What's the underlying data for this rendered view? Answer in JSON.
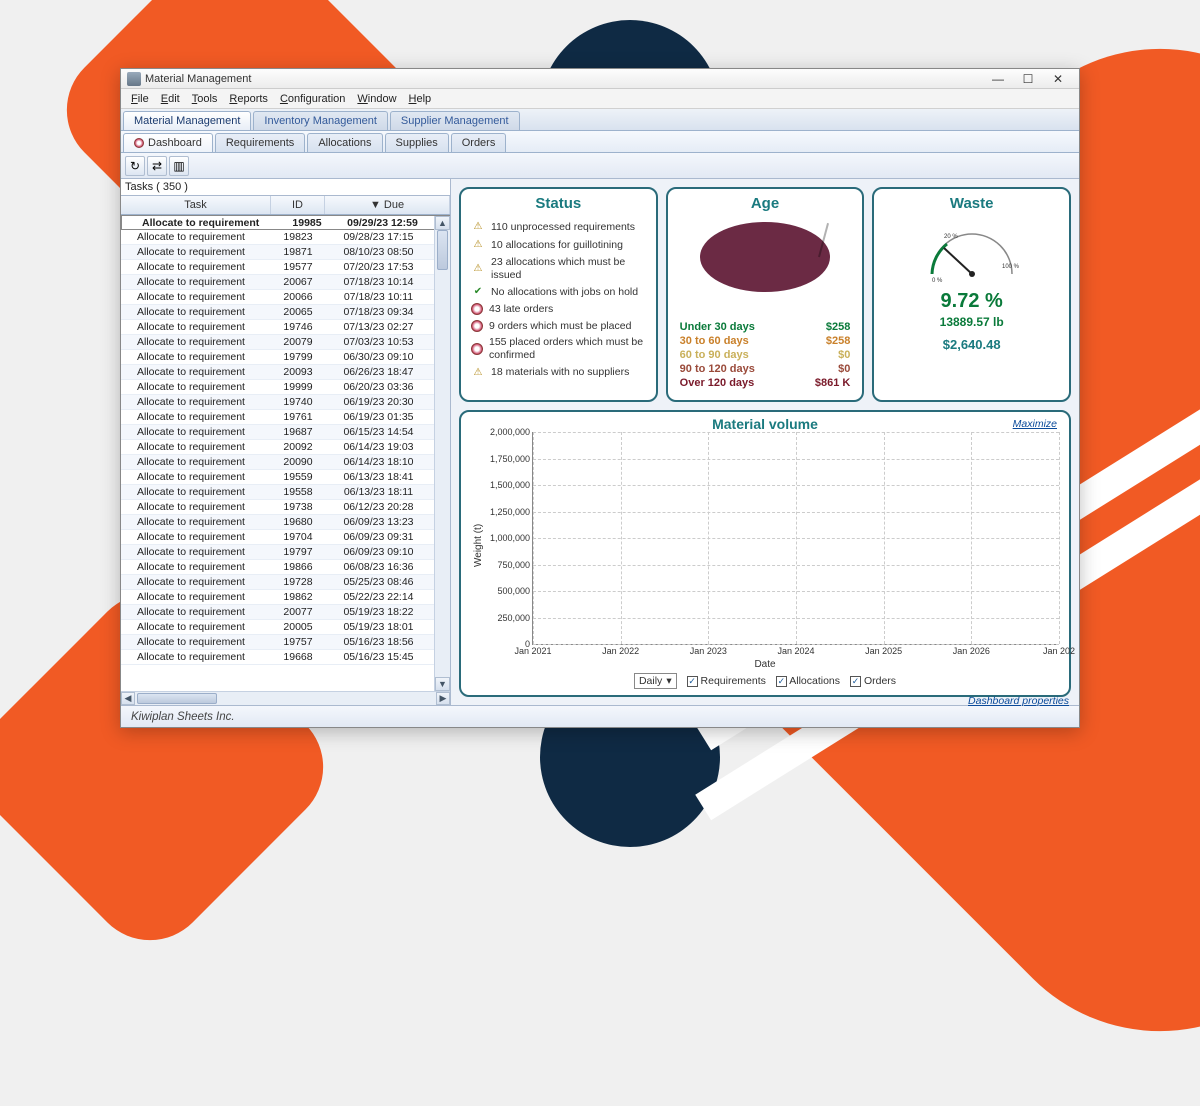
{
  "window": {
    "title": "Material Management"
  },
  "menubar": [
    "File",
    "Edit",
    "Tools",
    "Reports",
    "Configuration",
    "Window",
    "Help"
  ],
  "tabrow1": [
    "Material Management",
    "Inventory Management",
    "Supplier Management"
  ],
  "tabrow2": [
    "Dashboard",
    "Requirements",
    "Allocations",
    "Supplies",
    "Orders"
  ],
  "tasks_header": "Tasks ( 350 )",
  "table": {
    "columns": {
      "task": "Task",
      "id": "ID",
      "due": "▼ Due"
    },
    "rows": [
      {
        "task": "Allocate to requirement",
        "id": "19985",
        "due": "09/29/23 12:59",
        "sel": true
      },
      {
        "task": "Allocate to requirement",
        "id": "19823",
        "due": "09/28/23 17:15"
      },
      {
        "task": "Allocate to requirement",
        "id": "19871",
        "due": "08/10/23 08:50"
      },
      {
        "task": "Allocate to requirement",
        "id": "19577",
        "due": "07/20/23 17:53"
      },
      {
        "task": "Allocate to requirement",
        "id": "20067",
        "due": "07/18/23 10:14"
      },
      {
        "task": "Allocate to requirement",
        "id": "20066",
        "due": "07/18/23 10:11"
      },
      {
        "task": "Allocate to requirement",
        "id": "20065",
        "due": "07/18/23 09:34"
      },
      {
        "task": "Allocate to requirement",
        "id": "19746",
        "due": "07/13/23 02:27"
      },
      {
        "task": "Allocate to requirement",
        "id": "20079",
        "due": "07/03/23 10:53"
      },
      {
        "task": "Allocate to requirement",
        "id": "19799",
        "due": "06/30/23 09:10"
      },
      {
        "task": "Allocate to requirement",
        "id": "20093",
        "due": "06/26/23 18:47"
      },
      {
        "task": "Allocate to requirement",
        "id": "19999",
        "due": "06/20/23 03:36"
      },
      {
        "task": "Allocate to requirement",
        "id": "19740",
        "due": "06/19/23 20:30"
      },
      {
        "task": "Allocate to requirement",
        "id": "19761",
        "due": "06/19/23 01:35"
      },
      {
        "task": "Allocate to requirement",
        "id": "19687",
        "due": "06/15/23 14:54"
      },
      {
        "task": "Allocate to requirement",
        "id": "20092",
        "due": "06/14/23 19:03"
      },
      {
        "task": "Allocate to requirement",
        "id": "20090",
        "due": "06/14/23 18:10"
      },
      {
        "task": "Allocate to requirement",
        "id": "19559",
        "due": "06/13/23 18:41"
      },
      {
        "task": "Allocate to requirement",
        "id": "19558",
        "due": "06/13/23 18:11"
      },
      {
        "task": "Allocate to requirement",
        "id": "19738",
        "due": "06/12/23 20:28"
      },
      {
        "task": "Allocate to requirement",
        "id": "19680",
        "due": "06/09/23 13:23"
      },
      {
        "task": "Allocate to requirement",
        "id": "19704",
        "due": "06/09/23 09:31"
      },
      {
        "task": "Allocate to requirement",
        "id": "19797",
        "due": "06/09/23 09:10"
      },
      {
        "task": "Allocate to requirement",
        "id": "19866",
        "due": "06/08/23 16:36"
      },
      {
        "task": "Allocate to requirement",
        "id": "19728",
        "due": "05/25/23 08:46"
      },
      {
        "task": "Allocate to requirement",
        "id": "19862",
        "due": "05/22/23 22:14"
      },
      {
        "task": "Allocate to requirement",
        "id": "20077",
        "due": "05/19/23 18:22"
      },
      {
        "task": "Allocate to requirement",
        "id": "20005",
        "due": "05/19/23 18:01"
      },
      {
        "task": "Allocate to requirement",
        "id": "19757",
        "due": "05/16/23 18:56"
      },
      {
        "task": "Allocate to requirement",
        "id": "19668",
        "due": "05/16/23 15:45"
      }
    ]
  },
  "status": {
    "title": "Status",
    "items": [
      {
        "icon": "warn",
        "text": "110 unprocessed requirements"
      },
      {
        "icon": "warn",
        "text": "10 allocations for guillotining"
      },
      {
        "icon": "warn",
        "text": "23 allocations which must be issued"
      },
      {
        "icon": "ok",
        "text": "No allocations with jobs on hold"
      },
      {
        "icon": "disc",
        "text": "43 late orders"
      },
      {
        "icon": "disc",
        "text": "9 orders which must be placed"
      },
      {
        "icon": "disc",
        "text": "155 placed orders which must be confirmed"
      },
      {
        "icon": "warn",
        "text": "18 materials with no suppliers"
      }
    ]
  },
  "age": {
    "title": "Age",
    "rows": [
      {
        "label": "Under 30 days",
        "value": "$258"
      },
      {
        "label": "30 to 60 days",
        "value": "$258"
      },
      {
        "label": "60 to 90 days",
        "value": "$0"
      },
      {
        "label": "90 to 120 days",
        "value": "$0"
      },
      {
        "label": "Over 120 days",
        "value": "$861 K"
      }
    ]
  },
  "waste": {
    "title": "Waste",
    "gauge_ticks": {
      "left": "0 %",
      "top": "20 %",
      "right": "100 %"
    },
    "pct": "9.72 %",
    "weight": "13889.57 lb",
    "cash": "$2,640.48"
  },
  "chart": {
    "title": "Material volume",
    "maximize": "Maximize",
    "ylabel": "Weight (t)",
    "xlabel": "Date",
    "interval_label": "Daily",
    "legend": [
      "Requirements",
      "Allocations",
      "Orders"
    ],
    "yticks": [
      "0",
      "250,000",
      "500,000",
      "750,000",
      "1,000,000",
      "1,250,000",
      "1,500,000",
      "1,750,000",
      "2,000,000"
    ],
    "xticks": [
      "Jan 2021",
      "Jan 2022",
      "Jan 2023",
      "Jan 2024",
      "Jan 2025",
      "Jan 2026",
      "Jan 202"
    ]
  },
  "dash_props": "Dashboard properties",
  "statusbar": "Kiwiplan Sheets Inc.",
  "chart_data": {
    "type": "line",
    "title": "Material volume",
    "xlabel": "Date",
    "ylabel": "Weight (t)",
    "ylim": [
      0,
      2000000
    ],
    "x": [
      "Jan 2021",
      "Jan 2022",
      "Jan 2023",
      "Jan 2024",
      "Jan 2025",
      "Jan 2026"
    ],
    "series": [
      {
        "name": "Requirements",
        "values": [
          0,
          0,
          0,
          0,
          0,
          0
        ]
      },
      {
        "name": "Allocations",
        "values": [
          0,
          0,
          0,
          0,
          0,
          0
        ]
      },
      {
        "name": "Orders",
        "values": [
          0,
          0,
          0,
          0,
          0,
          0
        ]
      }
    ]
  }
}
